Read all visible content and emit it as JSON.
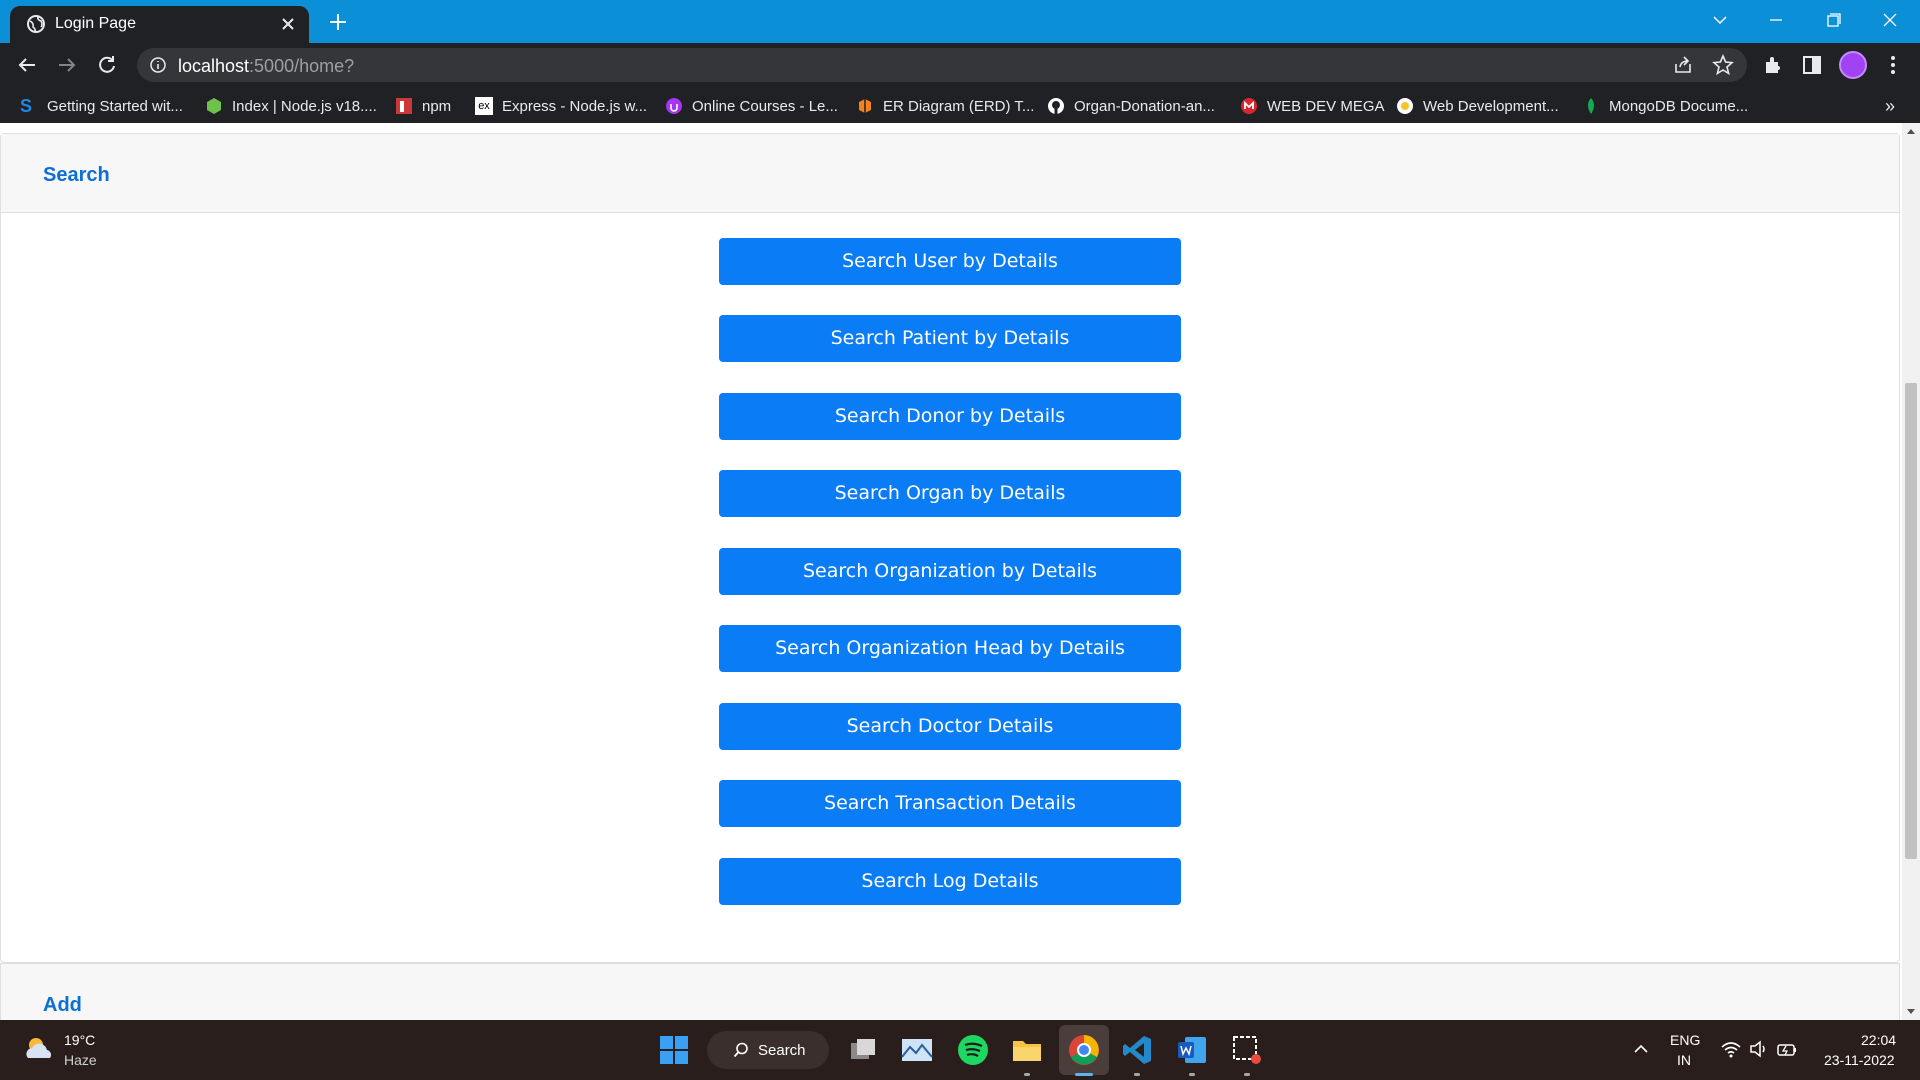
{
  "browser": {
    "tab_title": "Login Page",
    "url_host": "localhost",
    "url_path": ":5000/home?"
  },
  "bookmarks": [
    {
      "label": "Getting Started wit...",
      "icon": "s-logo-icon",
      "color": "#1e88e5"
    },
    {
      "label": "Index | Node.js v18....",
      "icon": "nodejs-icon",
      "color": "#6cc24a"
    },
    {
      "label": "npm",
      "icon": "npm-icon",
      "color": "#cb3837"
    },
    {
      "label": "Express - Node.js w...",
      "icon": "express-icon",
      "color": "#ffffff"
    },
    {
      "label": "Online Courses - Le...",
      "icon": "udemy-icon",
      "color": "#a435f0"
    },
    {
      "label": "ER Diagram (ERD) T...",
      "icon": "lucid-icon",
      "color": "#f5821f"
    },
    {
      "label": "Organ-Donation-an...",
      "icon": "github-icon",
      "color": "#ffffff"
    },
    {
      "label": "WEB DEV MEGA",
      "icon": "mega-icon",
      "color": "#d9272e"
    },
    {
      "label": "Web Development...",
      "icon": "web-dev-icon",
      "color": "#f4c430"
    },
    {
      "label": "MongoDB Docume...",
      "icon": "mongodb-icon",
      "color": "#13aa52"
    }
  ],
  "page": {
    "section_title": "Search",
    "buttons": [
      "Search User by Details",
      "Search Patient by Details",
      "Search Donor by Details",
      "Search Organ by Details",
      "Search Organization by Details",
      "Search Organization Head by Details",
      "Search Doctor Details",
      "Search Transaction Details",
      "Search Log Details"
    ],
    "next_section_title": "Add"
  },
  "taskbar": {
    "weather_temp": "19°C",
    "weather_desc": "Haze",
    "search_label": "Search",
    "lang_line1": "ENG",
    "lang_line2": "IN",
    "time": "22:04",
    "date": "23-11-2022"
  },
  "colors": {
    "accent": "#0a7cf5",
    "link": "#0b6fd6",
    "tabstrip": "#0b8fd6",
    "chrome_dark": "#202124"
  }
}
